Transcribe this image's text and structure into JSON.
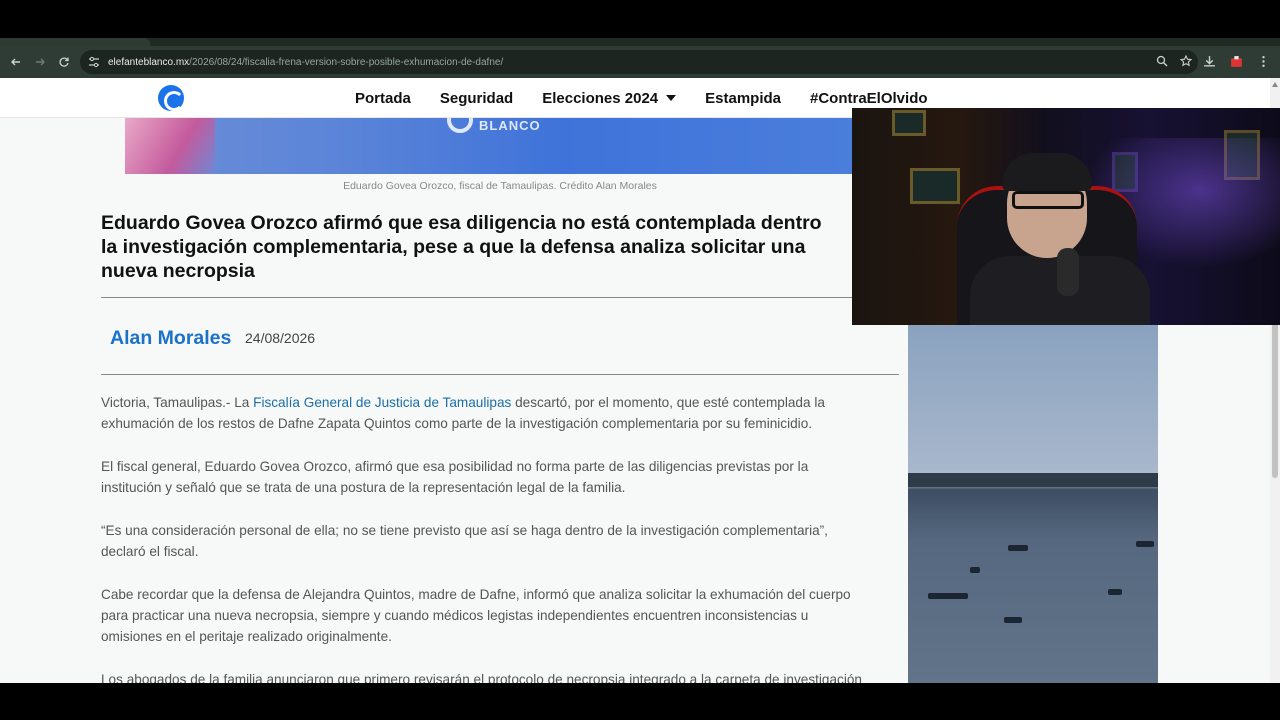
{
  "browser": {
    "url_host": "elefanteblanco.mx",
    "url_path": "/2026/08/24/fiscalia-frena-version-sobre-posible-exhumacion-de-dafne/"
  },
  "site": {
    "nav": [
      {
        "label": "Portada"
      },
      {
        "label": "Seguridad"
      },
      {
        "label": "Elecciones 2024",
        "has_dropdown": true
      },
      {
        "label": "Estampida"
      },
      {
        "label": "#ContraElOlvido"
      }
    ]
  },
  "article": {
    "hero_logo_text": "BLANCO",
    "caption": "Eduardo Govea Orozco, fiscal de Tamaulipas. Crédito Alan Morales",
    "headline": "Eduardo Govea Orozco afirmó que esa diligencia no está contemplada dentro\nla investigación complementaria, pese a que la defensa analiza solicitar una\nnueva necropsia",
    "author": "Alan Morales",
    "date": "24/08/2026",
    "p1_pre": "Victoria, Tamaulipas.- La ",
    "p1_link": "Fiscalía General de Justicia de Tamaulipas",
    "p1_post": " descartó, por el momento, que esté contemplada la\nexhumación de los restos de Dafne Zapata Quintos como parte de la investigación complementaria por su feminicidio.",
    "p2": "El fiscal general, Eduardo Govea Orozco, afirmó que esa posibilidad no forma parte de las diligencias previstas por la\ninstitución y señaló que se trata de una postura de la representación legal de la familia.",
    "p3": "“Es una consideración personal de ella; no se tiene previsto que así se haga dentro de la investigación complementaria”,\ndeclaró el fiscal.",
    "p4": "Cabe recordar que la defensa de Alejandra Quintos, madre de Dafne, informó que analiza solicitar la exhumación del cuerpo\npara practicar una nueva necropsia, siempre y cuando médicos legistas independientes encuentren inconsistencias u\nomisiones en el peritaje realizado originalmente.",
    "p5": "Los abogados de la familia anunciaron que primero revisarán el protocolo de necropsia integrado a la carpeta de investigación"
  }
}
